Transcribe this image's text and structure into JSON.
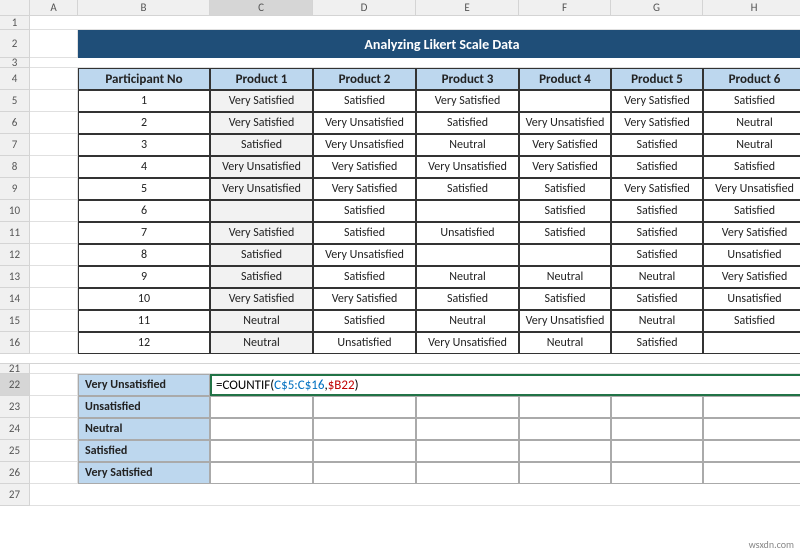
{
  "watermark": "wsxdn.com",
  "columns": [
    "A",
    "B",
    "C",
    "D",
    "E",
    "F",
    "G",
    "H"
  ],
  "rows_top": [
    "1",
    "2",
    "3",
    "4",
    "5",
    "6",
    "7",
    "8",
    "9",
    "10",
    "11",
    "12",
    "13",
    "14",
    "15",
    "16"
  ],
  "rows_bottom": [
    "21",
    "22",
    "23",
    "24",
    "25",
    "26",
    "27"
  ],
  "title": "Analyzing Likert Scale Data",
  "headers": [
    "Participant No",
    "Product 1",
    "Product 2",
    "Product 3",
    "Product 4",
    "Product 5",
    "Product 6"
  ],
  "data_rows": [
    {
      "pno": "1",
      "p1": "Very Satisfied",
      "p2": "Satisfied",
      "p3": "Very Satisfied",
      "p4": "",
      "p5": "Very Satisfied",
      "p6": "Satisfied"
    },
    {
      "pno": "2",
      "p1": "Very Satisfied",
      "p2": "Very Unsatisfied",
      "p3": "Satisfied",
      "p4": "Very Unsatisfied",
      "p5": "Very Satisfied",
      "p6": "Neutral"
    },
    {
      "pno": "3",
      "p1": "Satisfied",
      "p2": "Very Unsatisfied",
      "p3": "Neutral",
      "p4": "Very Satisfied",
      "p5": "Satisfied",
      "p6": "Neutral"
    },
    {
      "pno": "4",
      "p1": "Very Unsatisfied",
      "p2": "Very Satisfied",
      "p3": "Very Unsatisfied",
      "p4": "Very Satisfied",
      "p5": "Satisfied",
      "p6": "Satisfied"
    },
    {
      "pno": "5",
      "p1": "Very Unsatisfied",
      "p2": "Very Satisfied",
      "p3": "Satisfied",
      "p4": "Satisfied",
      "p5": "Very Satisfied",
      "p6": "Very Unsatisfied"
    },
    {
      "pno": "6",
      "p1": "",
      "p2": "Satisfied",
      "p3": "",
      "p4": "Satisfied",
      "p5": "Satisfied",
      "p6": "Satisfied"
    },
    {
      "pno": "7",
      "p1": "Very Satisfied",
      "p2": "Satisfied",
      "p3": "Unsatisfied",
      "p4": "Satisfied",
      "p5": "Satisfied",
      "p6": "Very Satisfied"
    },
    {
      "pno": "8",
      "p1": "Satisfied",
      "p2": "Very Unsatisfied",
      "p3": "",
      "p4": "",
      "p5": "Satisfied",
      "p6": "Unsatisfied"
    },
    {
      "pno": "9",
      "p1": "Satisfied",
      "p2": "Satisfied",
      "p3": "Neutral",
      "p4": "Neutral",
      "p5": "Neutral",
      "p6": "Very Satisfied"
    },
    {
      "pno": "10",
      "p1": "Very Satisfied",
      "p2": "Very Satisfied",
      "p3": "Satisfied",
      "p4": "Satisfied",
      "p5": "Satisfied",
      "p6": "Unsatisfied"
    },
    {
      "pno": "11",
      "p1": "Neutral",
      "p2": "Satisfied",
      "p3": "Neutral",
      "p4": "Very Unsatisfied",
      "p5": "Neutral",
      "p6": "Satisfied"
    },
    {
      "pno": "12",
      "p1": "Neutral",
      "p2": "Unsatisfied",
      "p3": "Very Unsatisfied",
      "p4": "Neutral",
      "p5": "Satisfied",
      "p6": ""
    }
  ],
  "categories": [
    "Very Unsatisfied",
    "Unsatisfied",
    "Neutral",
    "Satisfied",
    "Very Satisfied"
  ],
  "formula": {
    "prefix": "=COUNTIF(",
    "range": "C$5:C$16",
    "comma": ",",
    "crit": "$B22",
    "suffix": ")"
  }
}
